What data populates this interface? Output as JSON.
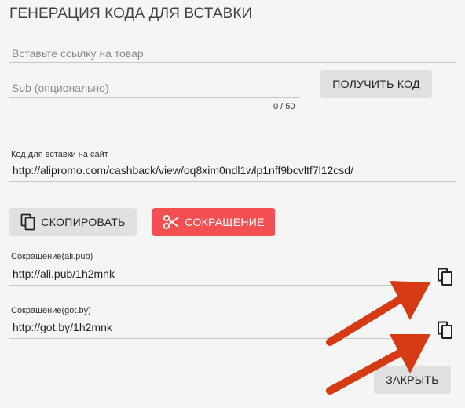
{
  "title": "ГЕНЕРАЦИЯ КОДА ДЛЯ ВСТАВКИ",
  "product_link": {
    "placeholder": "Вставьте ссылку на товар",
    "value": ""
  },
  "sub": {
    "placeholder": "Sub (опционально)",
    "counter": "0 / 50"
  },
  "get_code_button": "ПОЛУЧИТЬ КОД",
  "embed_code": {
    "label": "Код для вставки на сайт",
    "value": "http://alipromo.com/cashback/view/oq8xim0ndl1wlp1nff9bcvltf7l12csd/"
  },
  "copy_button": "СКОПИРОВАТЬ",
  "shorten_button": "СОКРАЩЕНИЕ",
  "short_links": [
    {
      "label": "Сокращение(ali.pub)",
      "value": "http://ali.pub/1h2mnk"
    },
    {
      "label": "Сокращение(got.by)",
      "value": "http://got.by/1h2mnk"
    }
  ],
  "close_button": "ЗАКРЫТЬ",
  "colors": {
    "accent_red": "#f44f52",
    "arrow": "#d63a12",
    "button_gray": "#e0e0e0"
  },
  "icons": [
    "copy-icon",
    "scissors-icon"
  ]
}
